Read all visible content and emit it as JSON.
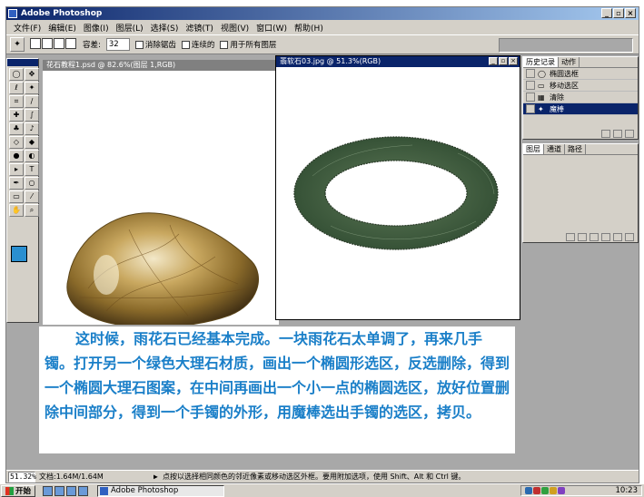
{
  "app": {
    "title": "Adobe Photoshop",
    "window_buttons": [
      "_",
      "▫",
      "×"
    ]
  },
  "menu": [
    "文件(F)",
    "编辑(E)",
    "图像(I)",
    "图层(L)",
    "选择(S)",
    "滤镜(T)",
    "视图(V)",
    "窗口(W)",
    "帮助(H)"
  ],
  "options": {
    "tolerance_label": "容差:",
    "tolerance_value": "32",
    "antialias_label": "消除锯齿",
    "contiguous_label": "连续的",
    "all_layers_label": "用于所有图层"
  },
  "doc1": {
    "title": "花石教程1.psd @ 82.6%(图层 1,RGB)"
  },
  "doc2": {
    "title": "翡软石03.jpg @ 51.3%(RGB)"
  },
  "history_panel": {
    "tabs": [
      "历史记录",
      "动作"
    ],
    "items": [
      {
        "label": "椭圆选框",
        "icon": "ellipse-marquee-icon"
      },
      {
        "label": "移动选区",
        "icon": "move-selection-icon"
      },
      {
        "label": "清除",
        "icon": "clear-icon"
      },
      {
        "label": "魔棒",
        "icon": "magic-wand-icon",
        "selected": true
      }
    ]
  },
  "layers_panel": {
    "tabs": [
      "图层",
      "通道",
      "路径"
    ]
  },
  "tutorial": {
    "text": "这时候，雨花石已经基本完成。一块雨花石太单调了，再来几手镯。打开另一个绿色大理石材质，画出一个椭圆形选区，反选删除，得到一个椭圆大理石图案，在中间再画出一个小一点的椭圆选区，放好位置删除中间部分，得到一个手镯的外形，用魔棒选出手镯的选区，拷贝。",
    "color": "#1a7fc8"
  },
  "status": {
    "zoom": "51.32%",
    "doc_info": "文档:1.64M/1.64M",
    "hint": "点按以选择相同颜色的邻近像素或移动选区外框。要用附加选项，使用 Shift、Alt 和 Ctrl 键。"
  },
  "taskbar": {
    "start": "开始",
    "app": "Adobe Photoshop",
    "clock": "10:23"
  },
  "colors": {
    "foreground": "#2a8fd0",
    "background": "#ffffff",
    "title_active": "#0a246a"
  }
}
